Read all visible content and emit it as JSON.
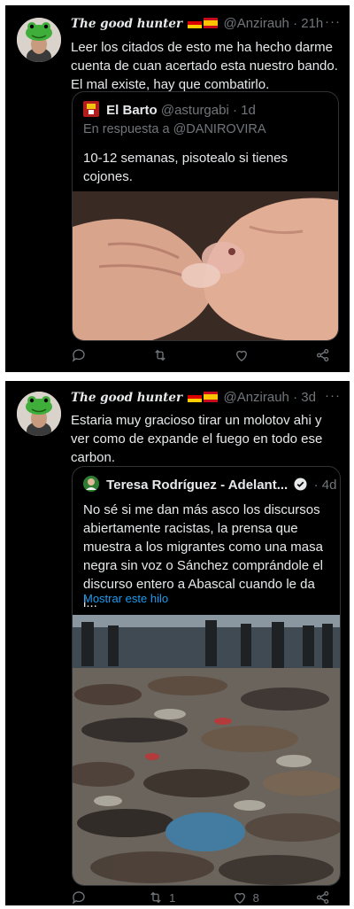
{
  "tweets": [
    {
      "author_name": "The good hunter",
      "handle": "@Anzirauh",
      "time": "· 21h",
      "more": "···",
      "text": "Leer los citados de esto me ha hecho darme cuenta de cuan acertado esta nuestro bando. El mal existe, hay que combatirlo.",
      "quote": {
        "author_name": "El Barto",
        "handle": "@asturgabi",
        "time": "· 1d",
        "reply_prefix": "En respuesta a",
        "reply_to": "@DANIROVIRA",
        "text": "10-12 semanas, pisotealo si tienes cojones."
      },
      "actions": {
        "reply": "",
        "retweet": "",
        "like": "",
        "share": ""
      }
    },
    {
      "author_name": "The good hunter",
      "handle": "@Anzirauh",
      "time": "· 3d",
      "more": "···",
      "text": "Estaria muy gracioso tirar un molotov ahi y ver como de expande el fuego en todo ese carbon.",
      "quote": {
        "author_name": "Teresa Rodríguez - Adelant...",
        "time": "· 4d",
        "text": "No sé si me dan más asco los  discursos abiertamente racistas, la prensa que muestra a los migrantes como una masa negra sin voz o Sánchez comprándole el discurso entero a Abascal cuando le da l...",
        "show_thread": "Mostrar este hilo"
      },
      "actions": {
        "reply": "",
        "retweet": "1",
        "like": "8",
        "share": ""
      }
    }
  ],
  "colors": {
    "background": "#000000",
    "text": "#e7e9ea",
    "secondary": "#71767b",
    "link": "#1d9bf0",
    "border": "#2f3336"
  },
  "icons": [
    "reply-icon",
    "retweet-icon",
    "like-icon",
    "share-icon",
    "verified-icon",
    "more-icon"
  ]
}
